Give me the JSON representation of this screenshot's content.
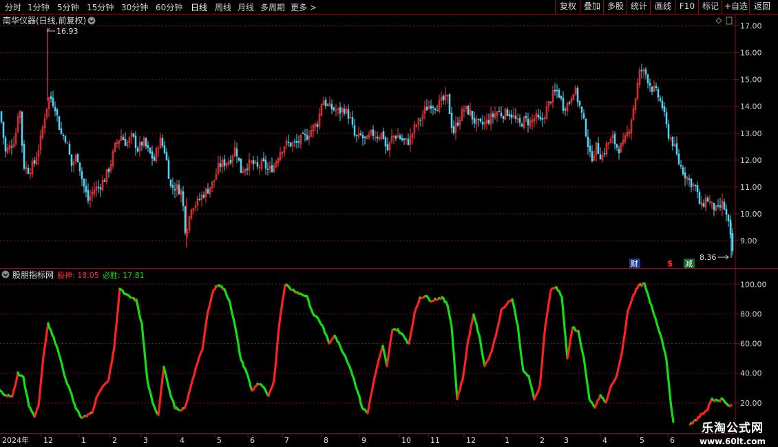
{
  "toolbar": {
    "periods": [
      "分时",
      "1分钟",
      "5分钟",
      "15分钟",
      "30分钟",
      "60分钟",
      "日线",
      "周线",
      "月线",
      "多周期",
      "更多 >"
    ],
    "active_period": "日线",
    "tools": [
      "复权",
      "叠加",
      "多股",
      "统计",
      "画线",
      "F10",
      "标记",
      "+自选",
      "返回"
    ]
  },
  "price_panel": {
    "title": "南华仪器(日线,前复权)",
    "high_label": "16.93",
    "low_label": "8.36",
    "markers": [
      "财",
      "$",
      "减"
    ]
  },
  "indicator_panel": {
    "title": "股朋指标网",
    "items": [
      {
        "label": "股神: 18.05",
        "color": "#ff3030"
      },
      {
        "label": "必胜: 17.81",
        "color": "#00e000"
      }
    ]
  },
  "x_axis": {
    "year_label": "2024年",
    "month_labels": [
      "12",
      "1",
      "2",
      "3",
      "4",
      "5",
      "6",
      "7",
      "8",
      "9",
      "10",
      "11",
      "12",
      "1",
      "2",
      "3",
      "4",
      "5",
      "6"
    ]
  },
  "watermark": {
    "line1": "乐淘公式网",
    "line2": "www.60lt.com"
  },
  "colors": {
    "up": "#ff3a3a",
    "down": "#54d0f0",
    "grid": "#8b1010",
    "ind_up": "#ff2020",
    "ind_down": "#10e010"
  },
  "chart_data": [
    {
      "type": "candlestick",
      "name": "南华仪器(日线,前复权)",
      "y_ticks": [
        9.0,
        10.0,
        11.0,
        12.0,
        13.0,
        14.0,
        15.0,
        16.0,
        17.0
      ],
      "ylim": [
        8.0,
        17.4
      ],
      "annotations": [
        {
          "label": "16.93",
          "value": 16.93
        },
        {
          "label": "8.36",
          "value": 8.36
        }
      ],
      "close_path": [
        [
          0,
          13.8
        ],
        [
          8,
          12.3
        ],
        [
          14,
          12.5
        ],
        [
          22,
          12.8
        ],
        [
          28,
          14.2
        ],
        [
          34,
          11.8
        ],
        [
          42,
          11.6
        ],
        [
          50,
          11.9
        ],
        [
          58,
          12.6
        ],
        [
          66,
          13.8
        ],
        [
          72,
          14.4
        ],
        [
          80,
          14.0
        ],
        [
          88,
          13.0
        ],
        [
          96,
          12.8
        ],
        [
          104,
          11.8
        ],
        [
          112,
          12.2
        ],
        [
          120,
          11.2
        ],
        [
          128,
          10.5
        ],
        [
          136,
          10.9
        ],
        [
          144,
          11.0
        ],
        [
          152,
          11.3
        ],
        [
          160,
          11.8
        ],
        [
          168,
          12.6
        ],
        [
          176,
          12.9
        ],
        [
          184,
          12.6
        ],
        [
          192,
          12.9
        ],
        [
          200,
          12.4
        ],
        [
          208,
          12.7
        ],
        [
          216,
          12.3
        ],
        [
          224,
          12.0
        ],
        [
          232,
          12.8
        ],
        [
          240,
          12.3
        ],
        [
          248,
          11.0
        ],
        [
          256,
          11.0
        ],
        [
          264,
          10.8
        ],
        [
          270,
          9.2
        ],
        [
          278,
          10.3
        ],
        [
          286,
          10.4
        ],
        [
          294,
          10.7
        ],
        [
          302,
          10.9
        ],
        [
          310,
          11.2
        ],
        [
          318,
          11.8
        ],
        [
          326,
          11.9
        ],
        [
          334,
          12.0
        ],
        [
          342,
          12.5
        ],
        [
          350,
          11.6
        ],
        [
          358,
          11.8
        ],
        [
          366,
          11.9
        ],
        [
          374,
          11.7
        ],
        [
          382,
          11.9
        ],
        [
          390,
          11.6
        ],
        [
          398,
          11.8
        ],
        [
          406,
          12.3
        ],
        [
          414,
          12.6
        ],
        [
          422,
          12.6
        ],
        [
          430,
          12.6
        ],
        [
          438,
          12.8
        ],
        [
          446,
          12.9
        ],
        [
          454,
          13.2
        ],
        [
          462,
          13.4
        ],
        [
          468,
          14.3
        ],
        [
          476,
          14.0
        ],
        [
          484,
          13.9
        ],
        [
          492,
          13.8
        ],
        [
          500,
          13.9
        ],
        [
          508,
          13.6
        ],
        [
          516,
          12.8
        ],
        [
          524,
          12.9
        ],
        [
          532,
          12.7
        ],
        [
          540,
          13.0
        ],
        [
          548,
          12.9
        ],
        [
          556,
          13.0
        ],
        [
          562,
          12.3
        ],
        [
          570,
          12.9
        ],
        [
          578,
          12.9
        ],
        [
          586,
          12.7
        ],
        [
          594,
          12.7
        ],
        [
          602,
          13.2
        ],
        [
          610,
          13.5
        ],
        [
          618,
          13.9
        ],
        [
          626,
          14.1
        ],
        [
          634,
          14.0
        ],
        [
          642,
          14.2
        ],
        [
          650,
          14.3
        ],
        [
          658,
          13.0
        ],
        [
          666,
          13.5
        ],
        [
          674,
          13.9
        ],
        [
          682,
          13.8
        ],
        [
          690,
          13.4
        ],
        [
          698,
          13.3
        ],
        [
          706,
          13.4
        ],
        [
          714,
          13.6
        ],
        [
          722,
          13.8
        ],
        [
          730,
          13.7
        ],
        [
          738,
          13.8
        ],
        [
          746,
          13.6
        ],
        [
          754,
          13.3
        ],
        [
          762,
          13.5
        ],
        [
          770,
          13.4
        ],
        [
          778,
          13.6
        ],
        [
          786,
          13.4
        ],
        [
          794,
          13.9
        ],
        [
          802,
          14.4
        ],
        [
          810,
          14.6
        ],
        [
          818,
          14.0
        ],
        [
          826,
          14.1
        ],
        [
          834,
          14.7
        ],
        [
          842,
          14.0
        ],
        [
          850,
          13.2
        ],
        [
          858,
          12.0
        ],
        [
          866,
          12.5
        ],
        [
          874,
          12.1
        ],
        [
          882,
          12.6
        ],
        [
          890,
          12.8
        ],
        [
          898,
          12.4
        ],
        [
          906,
          12.6
        ],
        [
          914,
          13.2
        ],
        [
          922,
          14.2
        ],
        [
          930,
          15.4
        ],
        [
          938,
          15.2
        ],
        [
          946,
          14.7
        ],
        [
          954,
          14.5
        ],
        [
          962,
          14.0
        ],
        [
          970,
          13.0
        ],
        [
          978,
          12.6
        ],
        [
          986,
          11.9
        ],
        [
          994,
          11.5
        ],
        [
          1002,
          11.2
        ],
        [
          1010,
          11.0
        ],
        [
          1018,
          10.2
        ],
        [
          1026,
          10.6
        ],
        [
          1034,
          10.3
        ],
        [
          1042,
          10.1
        ],
        [
          1050,
          10.4
        ],
        [
          1058,
          9.6
        ],
        [
          1064,
          8.6
        ]
      ]
    },
    {
      "type": "line",
      "name": "股朋指标网",
      "y_ticks": [
        20.0,
        40.0,
        60.0,
        80.0,
        100.0
      ],
      "ylim": [
        0,
        108
      ],
      "series": [
        {
          "name": "股神",
          "value_label": "18.05"
        },
        {
          "name": "必胜",
          "value_label": "17.81"
        }
      ],
      "line_path": [
        [
          0,
          28
        ],
        [
          10,
          25
        ],
        [
          18,
          24
        ],
        [
          26,
          40
        ],
        [
          34,
          37
        ],
        [
          42,
          18
        ],
        [
          50,
          11
        ],
        [
          56,
          18
        ],
        [
          64,
          55
        ],
        [
          70,
          73
        ],
        [
          78,
          64
        ],
        [
          86,
          53
        ],
        [
          94,
          38
        ],
        [
          102,
          28
        ],
        [
          110,
          17
        ],
        [
          118,
          10
        ],
        [
          126,
          11
        ],
        [
          134,
          14
        ],
        [
          142,
          26
        ],
        [
          150,
          31
        ],
        [
          158,
          36
        ],
        [
          166,
          58
        ],
        [
          174,
          97
        ],
        [
          182,
          93
        ],
        [
          190,
          91
        ],
        [
          198,
          89
        ],
        [
          206,
          73
        ],
        [
          214,
          35
        ],
        [
          222,
          19
        ],
        [
          230,
          12
        ],
        [
          238,
          45
        ],
        [
          246,
          28
        ],
        [
          254,
          17
        ],
        [
          262,
          14
        ],
        [
          270,
          18
        ],
        [
          278,
          33
        ],
        [
          286,
          46
        ],
        [
          294,
          56
        ],
        [
          302,
          82
        ],
        [
          310,
          96
        ],
        [
          318,
          100
        ],
        [
          326,
          96
        ],
        [
          334,
          88
        ],
        [
          342,
          70
        ],
        [
          350,
          49
        ],
        [
          358,
          41
        ],
        [
          366,
          28
        ],
        [
          374,
          33
        ],
        [
          382,
          31
        ],
        [
          390,
          24
        ],
        [
          398,
          35
        ],
        [
          406,
          75
        ],
        [
          414,
          100
        ],
        [
          422,
          97
        ],
        [
          430,
          95
        ],
        [
          438,
          93
        ],
        [
          446,
          92
        ],
        [
          454,
          80
        ],
        [
          462,
          77
        ],
        [
          470,
          70
        ],
        [
          478,
          60
        ],
        [
          486,
          66
        ],
        [
          494,
          58
        ],
        [
          502,
          51
        ],
        [
          510,
          42
        ],
        [
          518,
          30
        ],
        [
          526,
          17
        ],
        [
          534,
          13
        ],
        [
          540,
          28
        ],
        [
          548,
          45
        ],
        [
          556,
          58
        ],
        [
          562,
          45
        ],
        [
          570,
          70
        ],
        [
          578,
          69
        ],
        [
          586,
          65
        ],
        [
          594,
          60
        ],
        [
          602,
          80
        ],
        [
          610,
          91
        ],
        [
          618,
          92
        ],
        [
          626,
          89
        ],
        [
          634,
          90
        ],
        [
          642,
          91
        ],
        [
          650,
          86
        ],
        [
          656,
          72
        ],
        [
          664,
          23
        ],
        [
          672,
          36
        ],
        [
          680,
          62
        ],
        [
          688,
          80
        ],
        [
          696,
          65
        ],
        [
          704,
          45
        ],
        [
          712,
          52
        ],
        [
          720,
          65
        ],
        [
          728,
          82
        ],
        [
          736,
          87
        ],
        [
          744,
          90
        ],
        [
          752,
          72
        ],
        [
          760,
          41
        ],
        [
          768,
          38
        ],
        [
          776,
          22
        ],
        [
          784,
          31
        ],
        [
          792,
          72
        ],
        [
          800,
          96
        ],
        [
          808,
          98
        ],
        [
          816,
          92
        ],
        [
          824,
          50
        ],
        [
          832,
          71
        ],
        [
          840,
          68
        ],
        [
          848,
          50
        ],
        [
          856,
          22
        ],
        [
          864,
          17
        ],
        [
          872,
          25
        ],
        [
          880,
          20
        ],
        [
          888,
          32
        ],
        [
          896,
          38
        ],
        [
          904,
          56
        ],
        [
          912,
          82
        ],
        [
          920,
          93
        ],
        [
          928,
          99
        ],
        [
          936,
          100
        ],
        [
          944,
          88
        ],
        [
          952,
          77
        ],
        [
          960,
          65
        ],
        [
          968,
          50
        ],
        [
          974,
          20
        ],
        [
          978,
          8
        ]
      ],
      "tail_path": [
        [
          1002,
          5
        ],
        [
          1010,
          8
        ],
        [
          1018,
          12
        ],
        [
          1026,
          14
        ],
        [
          1034,
          23
        ],
        [
          1042,
          21
        ],
        [
          1050,
          23
        ],
        [
          1058,
          18
        ],
        [
          1062,
          18
        ]
      ]
    }
  ]
}
